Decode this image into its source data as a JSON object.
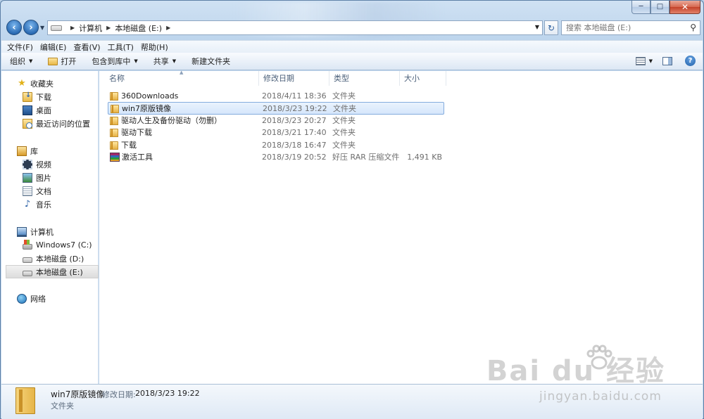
{
  "window": {
    "caption": {
      "minimize": "─",
      "maximize": "□",
      "close": "✕"
    }
  },
  "address": {
    "crumbs": [
      "计算机",
      "本地磁盘 (E:)"
    ],
    "search_placeholder": "搜索 本地磁盘 (E:)"
  },
  "menu": [
    "文件(F)",
    "编辑(E)",
    "查看(V)",
    "工具(T)",
    "帮助(H)"
  ],
  "commands": {
    "organize": "组织",
    "open": "打开",
    "include": "包含到库中",
    "share": "共享",
    "new_folder": "新建文件夹"
  },
  "nav": {
    "favorites": {
      "label": "收藏夹",
      "items": [
        "下载",
        "桌面",
        "最近访问的位置"
      ]
    },
    "libraries": {
      "label": "库",
      "items": [
        "视频",
        "图片",
        "文档",
        "音乐"
      ]
    },
    "computer": {
      "label": "计算机",
      "items": [
        "Windows7 (C:)",
        "本地磁盘 (D:)",
        "本地磁盘 (E:)"
      ]
    },
    "network": {
      "label": "网络"
    }
  },
  "columns": [
    "名称",
    "修改日期",
    "类型",
    "大小"
  ],
  "files": [
    {
      "name": "360Downloads",
      "date": "2018/4/11 18:36",
      "type": "文件夹",
      "size": "",
      "icon": "folder-icon"
    },
    {
      "name": "win7原版镜像",
      "date": "2018/3/23 19:22",
      "type": "文件夹",
      "size": "",
      "icon": "folder-icon",
      "selected": true
    },
    {
      "name": "驱动人生及备份驱动（勿删）",
      "date": "2018/3/23 20:27",
      "type": "文件夹",
      "size": "",
      "icon": "folder-icon"
    },
    {
      "name": "驱动下载",
      "date": "2018/3/21 17:40",
      "type": "文件夹",
      "size": "",
      "icon": "folder-icon"
    },
    {
      "name": "下载",
      "date": "2018/3/18 16:47",
      "type": "文件夹",
      "size": "",
      "icon": "folder-icon"
    },
    {
      "name": "激活工具",
      "date": "2018/3/19 20:52",
      "type": "好压 RAR 压缩文件",
      "size": "1,491 KB",
      "icon": "rar-archive-icon"
    }
  ],
  "details": {
    "name": "win7原版镜像",
    "modified_label": "修改日期:",
    "modified_value": "2018/3/23 19:22",
    "type": "文件夹"
  },
  "watermark": {
    "main": "Bai du 经验",
    "sub": "jingyan.baidu.com"
  }
}
